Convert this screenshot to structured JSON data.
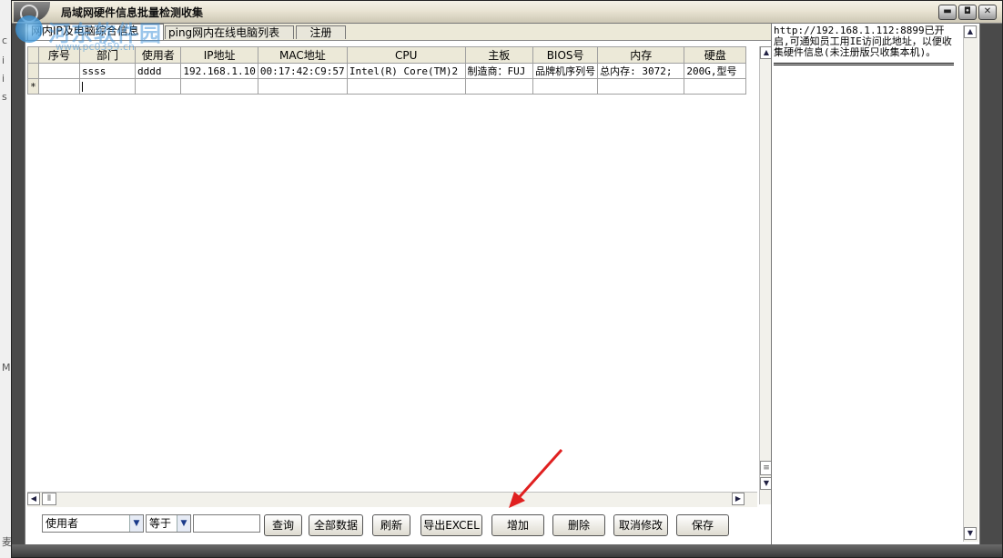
{
  "left_strip": [
    "c",
    "i",
    "i",
    "s",
    "M",
    "麦"
  ],
  "window": {
    "title": "局域网硬件信息批量检测收集",
    "controls": [
      "minimize",
      "restore",
      "close"
    ]
  },
  "watermark": {
    "text": "河东软件园",
    "sub": "www.pc0359.cn"
  },
  "tabs": [
    {
      "label": "网内IP及电脑综合信息",
      "active": true
    },
    {
      "label": "ping网内在线电脑列表",
      "active": false
    },
    {
      "label": "注册",
      "active": false
    }
  ],
  "table": {
    "columns": [
      "序号",
      "部门",
      "使用者",
      "IP地址",
      "MAC地址",
      "CPU",
      "主板",
      "BIOS号",
      "内存",
      "硬盘"
    ],
    "rows": [
      [
        "",
        "ssss",
        "dddd",
        "192.168.1.10",
        "00:17:42:C9:57",
        "Intel(R) Core(TM)2",
        "制造商：FUJ",
        "品牌机序列号",
        "总内存: 3072;",
        "200G,型号"
      ]
    ],
    "new_row_marker": "*"
  },
  "filter": {
    "field_value": "使用者",
    "operator_value": "等于",
    "query_value": ""
  },
  "buttons": {
    "query": "查询",
    "all_data": "全部数据",
    "refresh": "刷新",
    "export": "导出EXCEL",
    "add": "增加",
    "delete": "删除",
    "cancel_edit": "取消修改",
    "save": "保存"
  },
  "info": {
    "text": "http://192.168.1.112:8899已开启,可通知员工用IE访问此地址，以便收集硬件信息(未注册版只收集本机)。"
  },
  "colors": {
    "frame": "#4a4a4a",
    "titlebar": "#e9e4d3",
    "arrow": "#e02020"
  }
}
